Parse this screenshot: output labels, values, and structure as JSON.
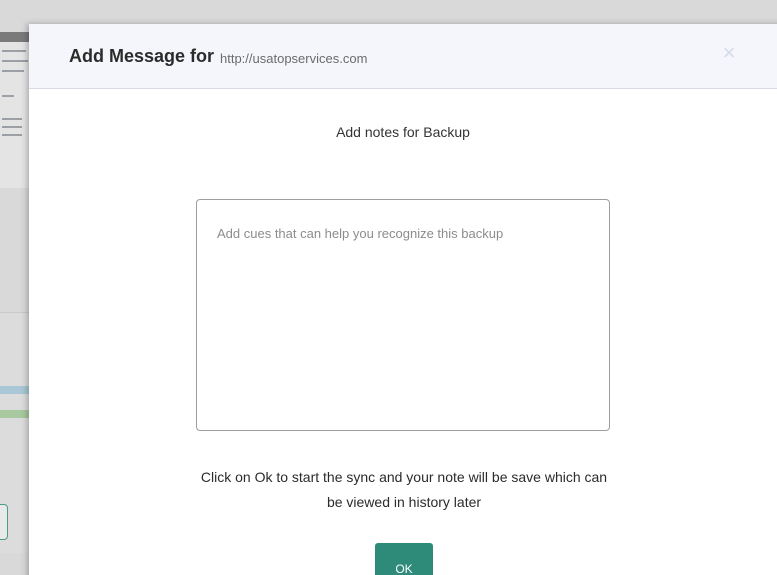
{
  "modal": {
    "title": "Add Message for",
    "url": "http://usatopservices.com",
    "close_icon": "×",
    "heading": "Add notes for Backup",
    "notes_placeholder": "Add cues that can help you recognize this backup",
    "notes_value": "",
    "info_text": "Click on Ok to start the sync and your note will be save which can be viewed in history later",
    "ok_label": "OK"
  },
  "colors": {
    "header_bg": "#f4f6fb",
    "ok_button": "#2e8b79",
    "overlay_bg": "#d9d9d9"
  },
  "icons": {
    "close": "close-icon"
  }
}
